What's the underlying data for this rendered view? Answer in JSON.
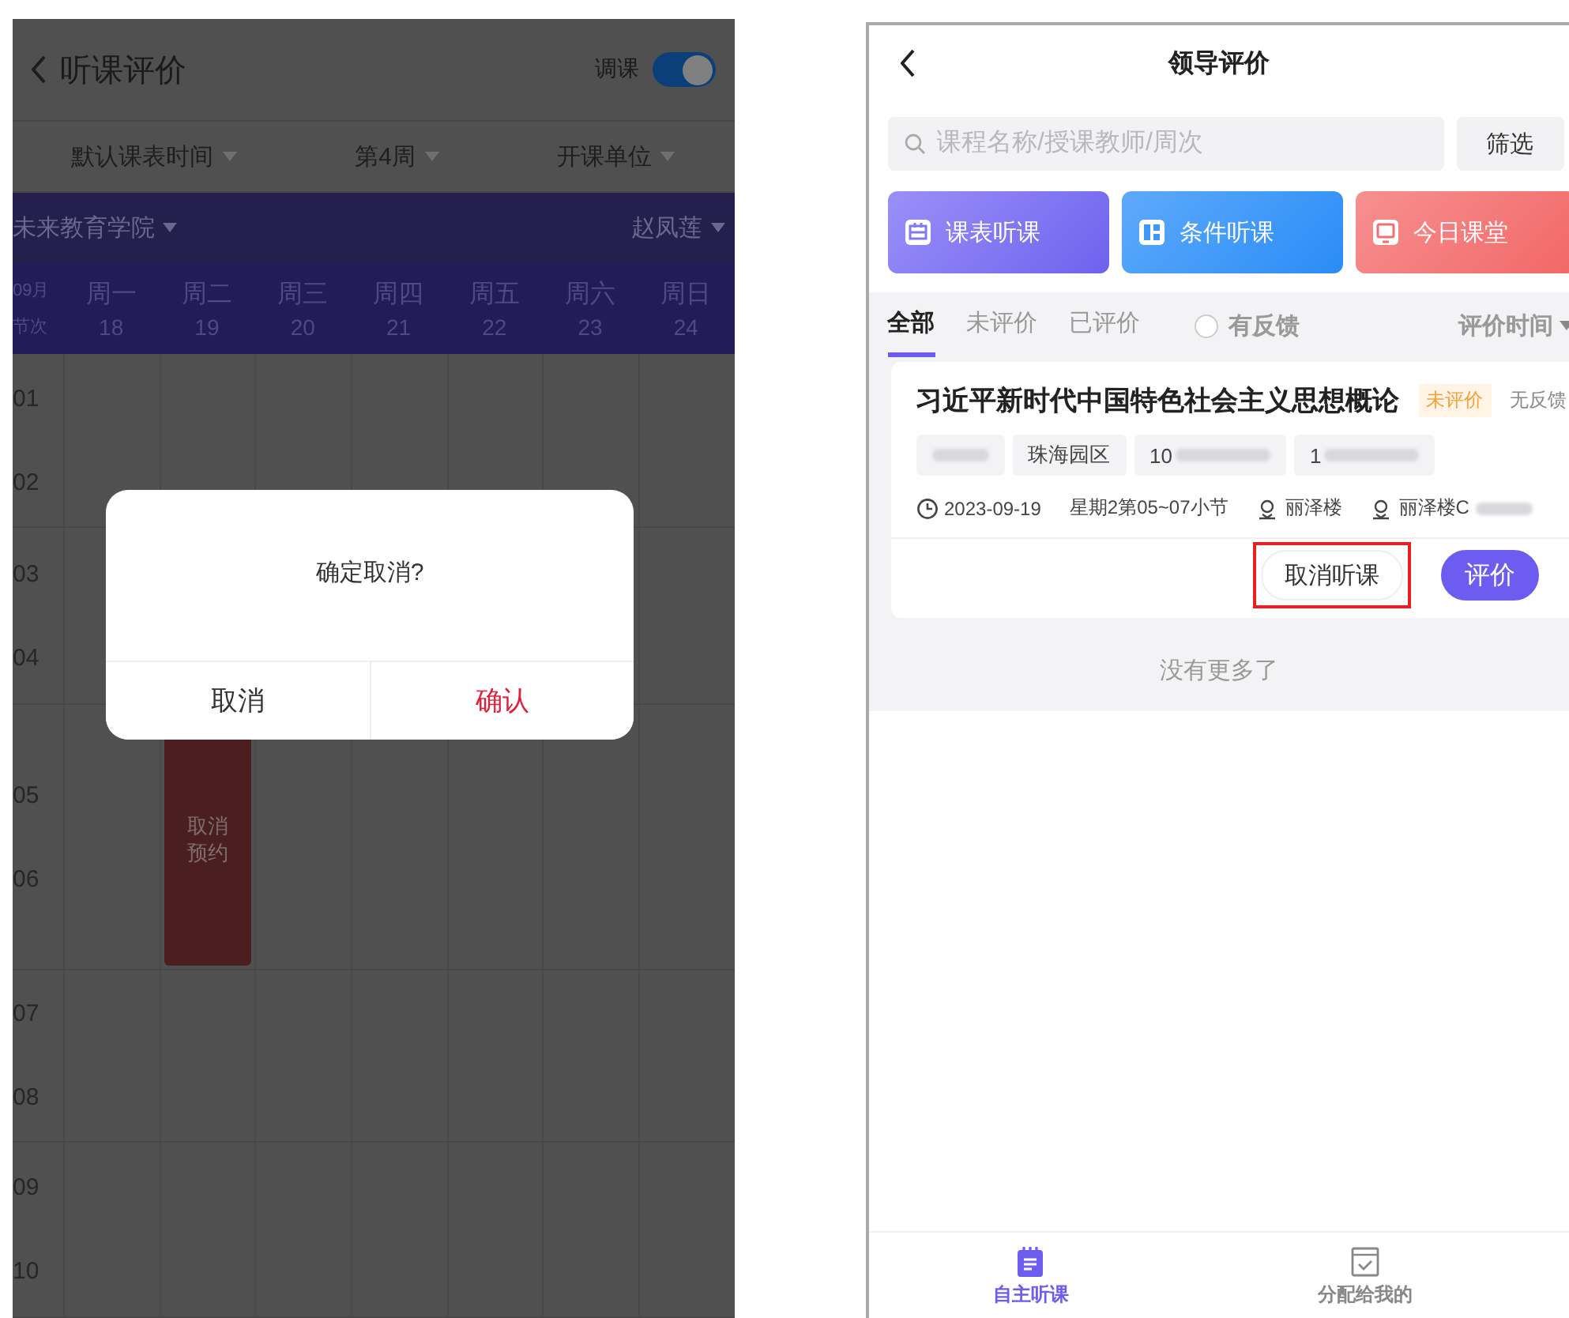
{
  "left_screen": {
    "header": {
      "title": "听课评价",
      "switch_label": "调课",
      "switch_on": true
    },
    "filters": [
      {
        "label": "默认课表时间"
      },
      {
        "label": "第4周"
      },
      {
        "label": "开课单位"
      }
    ],
    "unit_bar": {
      "college": "未来教育学院",
      "teacher": "赵凤莲"
    },
    "week_header": {
      "month": "09月",
      "period_label": "节次",
      "days": [
        {
          "weekday": "周一",
          "date": "18"
        },
        {
          "weekday": "周二",
          "date": "19",
          "course": {
            "action_lines": [
              "取消",
              "预约"
            ]
          }
        },
        {
          "weekday": "周三",
          "date": "20"
        },
        {
          "weekday": "周四",
          "date": "21"
        },
        {
          "weekday": "周五",
          "date": "22"
        },
        {
          "weekday": "周六",
          "date": "23"
        },
        {
          "weekday": "周日",
          "date": "24"
        }
      ]
    },
    "period_groups": [
      {
        "periods": [
          "01",
          "02"
        ]
      },
      {
        "periods": [
          "03",
          "04"
        ]
      },
      {
        "periods": [
          "05",
          "06"
        ]
      },
      {
        "periods": [
          "07",
          "08"
        ]
      },
      {
        "periods": [
          "09",
          "10"
        ]
      }
    ],
    "dialog": {
      "message": "确定取消?",
      "buttons": [
        {
          "label": "取消",
          "kind": "cancel"
        },
        {
          "label": "确认",
          "kind": "confirm"
        }
      ]
    }
  },
  "right_screen": {
    "header": {
      "title": "领导评价"
    },
    "search": {
      "placeholder": "课程名称/授课教师/周次"
    },
    "filter_button": "筛选",
    "quick_actions": [
      {
        "label": "课表听课",
        "kind": "purple"
      },
      {
        "label": "条件听课",
        "kind": "blue"
      },
      {
        "label": "今日课堂",
        "kind": "red"
      }
    ],
    "tabs": [
      {
        "label": "全部",
        "selected": true
      },
      {
        "label": "未评价",
        "selected": false
      },
      {
        "label": "已评价",
        "selected": false
      }
    ],
    "feedback_filter": {
      "label": "有反馈",
      "checked": false
    },
    "sort": {
      "label": "评价时间"
    },
    "card": {
      "title": "习近平新时代中国特色社会主义思想概论",
      "status": "未评价",
      "feedback": "无反馈",
      "tags": [
        {
          "kind": "redacted"
        },
        {
          "kind": "plain",
          "text": "珠海园区"
        },
        {
          "kind": "partial",
          "text": "10"
        },
        {
          "kind": "partial",
          "text": "1"
        }
      ],
      "info": [
        {
          "kind": "date",
          "text": "2023-09-19"
        },
        {
          "kind": "plain",
          "text": "星期2第05~07小节"
        },
        {
          "kind": "place",
          "text": "丽泽楼"
        },
        {
          "kind": "place_partial",
          "text": "丽泽楼C"
        }
      ],
      "actions": [
        {
          "label": "取消听课",
          "kind": "outline",
          "highlighted": true
        },
        {
          "label": "评价",
          "kind": "primary",
          "highlighted": false
        }
      ]
    },
    "end_note": "没有更多了",
    "bottom_nav": [
      {
        "label": "自主听课",
        "selected": true
      },
      {
        "label": "分配给我的",
        "selected": false
      }
    ]
  }
}
